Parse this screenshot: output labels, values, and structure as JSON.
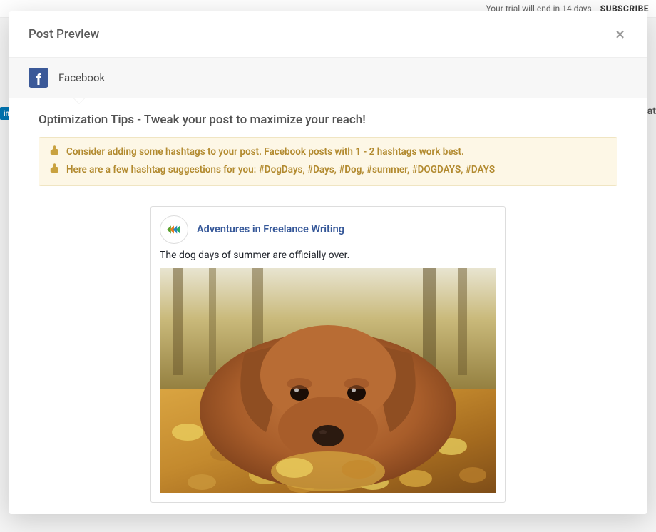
{
  "backdrop": {
    "trial_text": "Your trial will end in 14 days",
    "subscribe": "SUBSCRIBE",
    "linkedin_label": "in",
    "cat_text": "Cat"
  },
  "modal": {
    "title": "Post Preview"
  },
  "platform": {
    "name": "Facebook",
    "icon_letter": "f"
  },
  "tips": {
    "heading": "Optimization Tips - Tweak your post to maximize your reach!",
    "items": [
      "Consider adding some hashtags to your post. Facebook posts with 1 - 2 hashtags work best.",
      "Here are a few hashtag suggestions for you: #DogDays, #Days, #Dog, #summer, #DOGDAYS, #DAYS"
    ]
  },
  "post": {
    "page_name": "Adventures in Freelance Writing",
    "text": "The dog days of summer are officially over.",
    "image_alt": "Golden retriever dog lying in autumn leaves"
  }
}
